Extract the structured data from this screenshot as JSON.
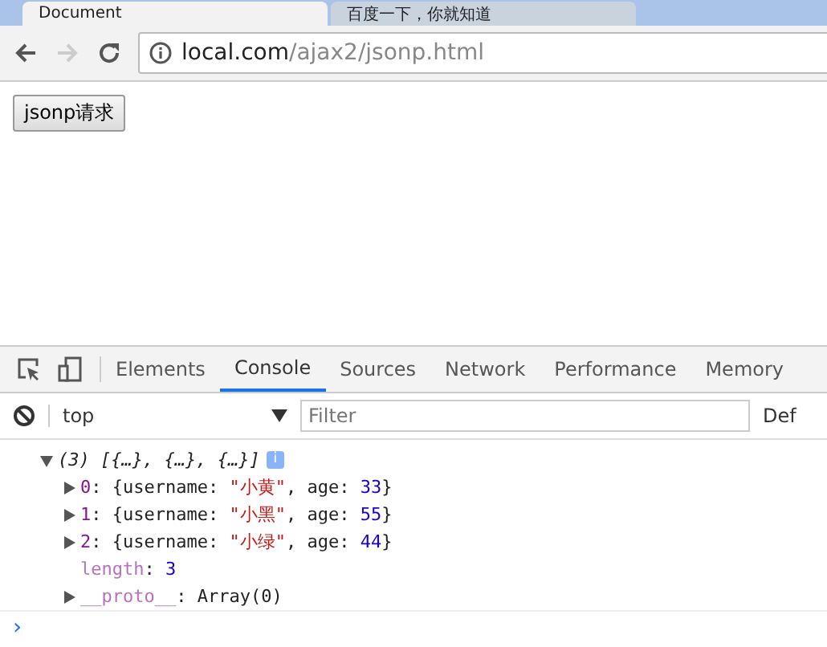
{
  "browser_tabs": [
    {
      "title": "Document",
      "selected": true
    },
    {
      "title": "百度一下，你就知道",
      "selected": false
    }
  ],
  "address_bar": {
    "host": "local.com",
    "path": "/ajax2/jsonp.html"
  },
  "page": {
    "button": "jsonp请求"
  },
  "devtools": {
    "tabs": [
      {
        "label": "Elements",
        "selected": false
      },
      {
        "label": "Console",
        "selected": true
      },
      {
        "label": "Sources",
        "selected": false
      },
      {
        "label": "Network",
        "selected": false
      },
      {
        "label": "Performance",
        "selected": false
      },
      {
        "label": "Memory",
        "selected": false
      }
    ],
    "context": "top",
    "filter_placeholder": "Filter",
    "levels": "Def",
    "console": [
      {
        "expanded": true,
        "segments": [
          {
            "kind": "italic",
            "text": "(3) [{…}, {…}, {…}]"
          }
        ],
        "info": "i",
        "children": [
          {
            "expanded": false,
            "segments": [
              {
                "kind": "index",
                "text": "0"
              },
              {
                "kind": "punct",
                "text": ": {username: "
              },
              {
                "kind": "string",
                "text": "\"小黄\""
              },
              {
                "kind": "punct",
                "text": ", age: "
              },
              {
                "kind": "number",
                "text": "33"
              },
              {
                "kind": "punct",
                "text": "}"
              }
            ]
          },
          {
            "expanded": false,
            "segments": [
              {
                "kind": "index",
                "text": "1"
              },
              {
                "kind": "punct",
                "text": ": {username: "
              },
              {
                "kind": "string",
                "text": "\"小黑\""
              },
              {
                "kind": "punct",
                "text": ", age: "
              },
              {
                "kind": "number",
                "text": "55"
              },
              {
                "kind": "punct",
                "text": "}"
              }
            ]
          },
          {
            "expanded": false,
            "segments": [
              {
                "kind": "index",
                "text": "2"
              },
              {
                "kind": "punct",
                "text": ": {username: "
              },
              {
                "kind": "string",
                "text": "\"小绿\""
              },
              {
                "kind": "punct",
                "text": ", age: "
              },
              {
                "kind": "number",
                "text": "44"
              },
              {
                "kind": "punct",
                "text": "}"
              }
            ]
          },
          {
            "segments": [
              {
                "kind": "meta",
                "text": "length"
              },
              {
                "kind": "punct",
                "text": ": "
              },
              {
                "kind": "number",
                "text": "3"
              }
            ]
          },
          {
            "expanded": false,
            "segments": [
              {
                "kind": "meta",
                "text": "__proto__"
              },
              {
                "kind": "punct",
                "text": ": Array(0)"
              }
            ]
          }
        ]
      }
    ],
    "prompt": "›"
  }
}
